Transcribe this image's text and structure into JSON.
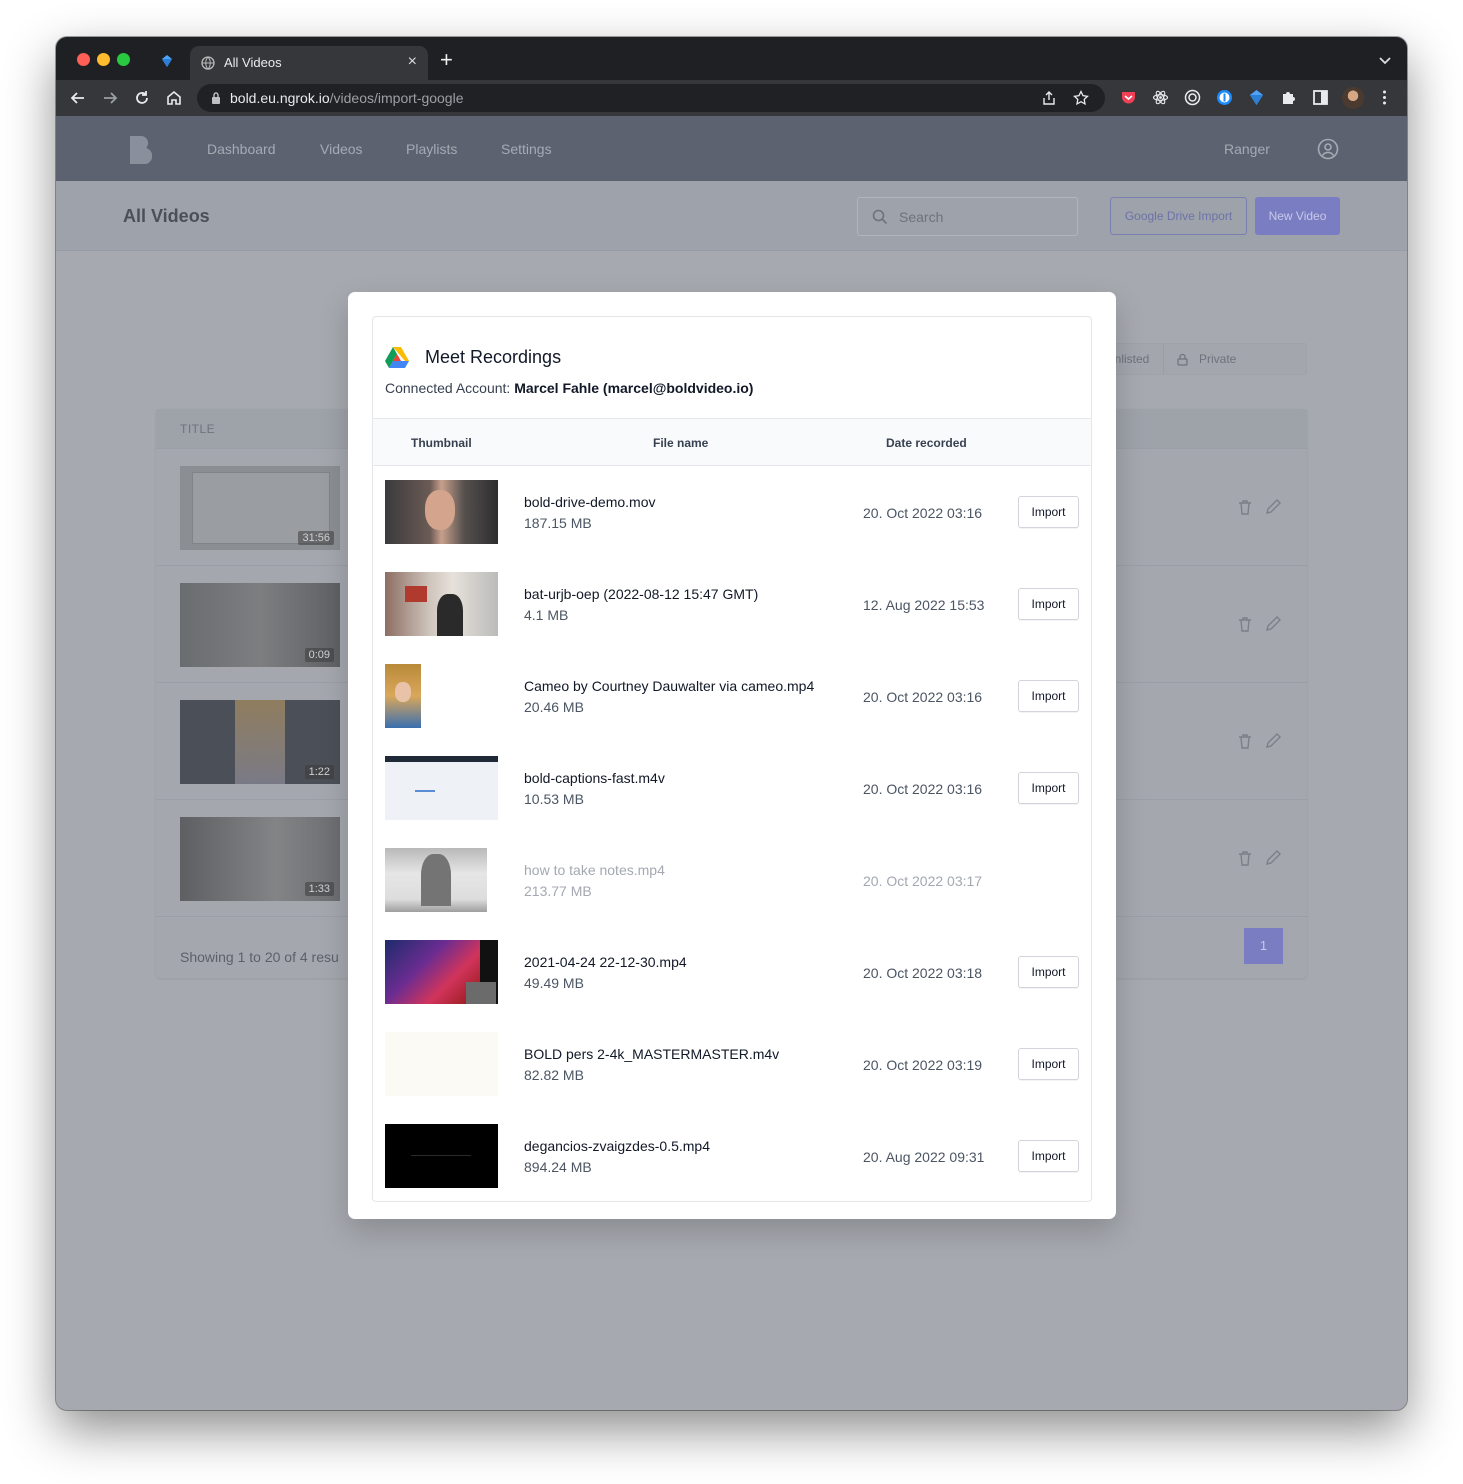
{
  "browser": {
    "tab_title": "All Videos",
    "tab_close": "×",
    "new_tab": "+",
    "url_host": "bold.eu.ngrok.io",
    "url_path": "/videos/import-google"
  },
  "app_nav": {
    "links": [
      "Dashboard",
      "Videos",
      "Playlists",
      "Settings"
    ],
    "team": "Ranger"
  },
  "page_header": {
    "title": "All Videos",
    "search_placeholder": "Search",
    "google_drive_import": "Google Drive Import",
    "new_video": "New Video"
  },
  "filters": {
    "unlisted": "Unlisted",
    "private": "Private"
  },
  "videos_table": {
    "column_title": "TITLE",
    "rows": [
      {
        "duration": "31:56"
      },
      {
        "duration": "0:09"
      },
      {
        "duration": "1:22"
      },
      {
        "duration": "1:33"
      }
    ],
    "footer": "Showing 1 to 20 of 4 resu",
    "page": "1"
  },
  "modal": {
    "title": "Meet Recordings",
    "account_label": "Connected Account:",
    "account_value": "Marcel Fahle (marcel@boldvideo.io)",
    "columns": {
      "thumbnail": "Thumbnail",
      "file_name": "File name",
      "date_recorded": "Date recorded"
    },
    "files": [
      {
        "name": "bold-drive-demo.mov",
        "size": "187.15 MB",
        "date": "20. Oct 2022 03:16",
        "action": "Import",
        "importable": true
      },
      {
        "name": "bat-urjb-oep (2022-08-12 15:47 GMT)",
        "size": "4.1 MB",
        "date": "12. Aug 2022 15:53",
        "action": "Import",
        "importable": true
      },
      {
        "name": "Cameo by Courtney Dauwalter via cameo.mp4",
        "size": "20.46 MB",
        "date": "20. Oct 2022 03:16",
        "action": "Import",
        "importable": true
      },
      {
        "name": "bold-captions-fast.m4v",
        "size": "10.53 MB",
        "date": "20. Oct 2022 03:16",
        "action": "Import",
        "importable": true
      },
      {
        "name": "how to take notes.mp4",
        "size": "213.77 MB",
        "date": "20. Oct 2022 03:17",
        "action": "",
        "importable": false
      },
      {
        "name": "2021-04-24 22-12-30.mp4",
        "size": "49.49 MB",
        "date": "20. Oct 2022 03:18",
        "action": "Import",
        "importable": true
      },
      {
        "name": "BOLD pers 2-4k_MASTERMASTER.m4v",
        "size": "82.82 MB",
        "date": "20. Oct 2022 03:19",
        "action": "Import",
        "importable": true
      },
      {
        "name": "degancios-zvaigzdes-0.5.mp4",
        "size": "894.24 MB",
        "date": "20. Aug 2022 09:31",
        "action": "Import",
        "importable": true
      }
    ]
  }
}
